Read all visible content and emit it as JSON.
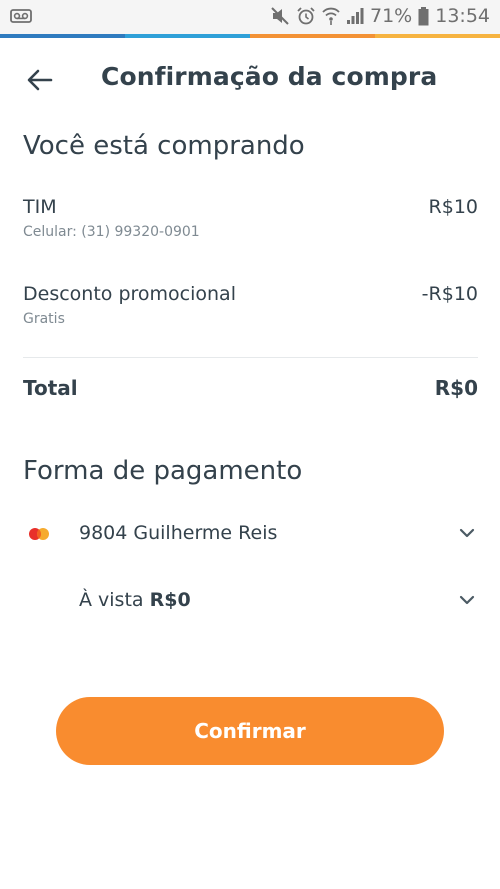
{
  "status_bar": {
    "battery": "71%",
    "time": "13:54",
    "icons": [
      "voicemail-icon",
      "mute-icon",
      "alarm-icon",
      "wifi-icon",
      "signal-icon",
      "battery-icon"
    ]
  },
  "accent_colors": [
    "#2f7bbf",
    "#2fa0d8",
    "#f39235",
    "#f6b340"
  ],
  "header": {
    "title": "Confirmação da compra",
    "back_icon": "arrow-left-icon"
  },
  "purchase": {
    "section_title": "Você está comprando",
    "items": [
      {
        "name": "TIM",
        "detail": "Celular: (31) 99320-0901",
        "amount": "R$10"
      },
      {
        "name": "Desconto promocional",
        "detail": "Gratis",
        "amount": "-R$10"
      }
    ],
    "total_label": "Total",
    "total_value": "R$0"
  },
  "payment": {
    "section_title": "Forma de pagamento",
    "card": {
      "icon": "mastercard-icon",
      "label": "9804 Guilherme Reis"
    },
    "installment": {
      "prefix": "À vista",
      "amount": "R$0"
    }
  },
  "confirm_button": {
    "label": "Confirmar",
    "color": "#f98c2f"
  }
}
